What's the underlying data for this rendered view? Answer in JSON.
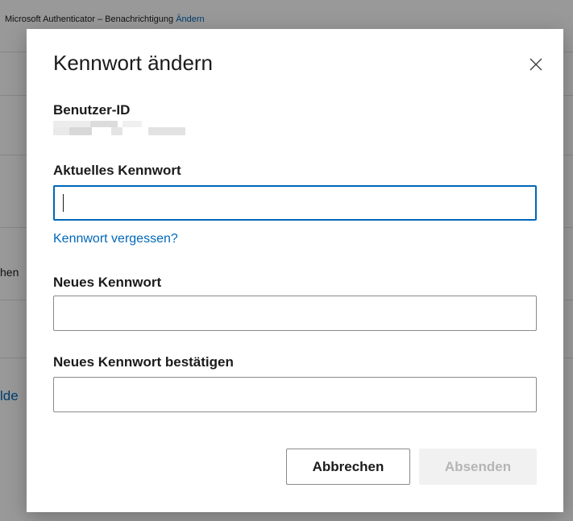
{
  "background": {
    "topbar_text": "Microsoft Authenticator – Benachrichtigung",
    "topbar_link": "Ändern",
    "side_text_1": "hen",
    "side_text_2": "lde"
  },
  "dialog": {
    "title": "Kennwort ändern",
    "close_icon": "close-icon",
    "userid_label": "Benutzer-ID",
    "current_password_label": "Aktuelles Kennwort",
    "current_password_value": "",
    "forgot_link": "Kennwort vergessen?",
    "new_password_label": "Neues Kennwort",
    "new_password_value": "",
    "confirm_password_label": "Neues Kennwort bestätigen",
    "confirm_password_value": "",
    "cancel_label": "Abbrechen",
    "submit_label": "Absenden"
  },
  "colors": {
    "accent": "#0067b8",
    "overlay": "rgba(0,0,0,0.40)",
    "disabled_bg": "#f1f1f1",
    "disabled_text": "#b5b5b5"
  }
}
